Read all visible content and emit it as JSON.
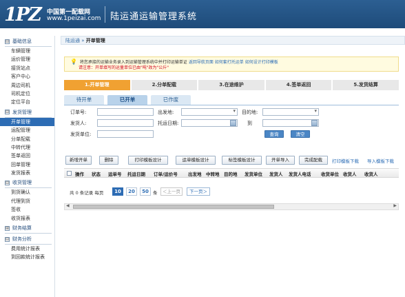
{
  "header": {
    "logo_mark": "1PZ",
    "logo_cn": "中国第一配载网",
    "logo_url": "www.1peizai.com",
    "app_title": "陆运通运输管理系统"
  },
  "sidebar": {
    "sections": [
      {
        "title": "基础信息",
        "toggle": "⊟",
        "items": [
          "车辆管理",
          "运价管理",
          "接货站点",
          "客户中心",
          "周边司机",
          "司机定位",
          "定位平台"
        ]
      },
      {
        "title": "发货管理",
        "toggle": "⊟",
        "items": [
          "开单管理",
          "运配管理",
          "分单配载",
          "中转代理",
          "签单返回",
          "回单管理",
          "发货报表"
        ]
      },
      {
        "title": "收货管理",
        "toggle": "⊟",
        "items": [
          "到货确认",
          "代理到货",
          "签收",
          "收货报表"
        ]
      },
      {
        "title": "财务结算",
        "toggle": "⊞",
        "items": []
      },
      {
        "title": "财务分析",
        "toggle": "⊟",
        "items": [
          "费用统计报表",
          "到回款统计报表"
        ]
      }
    ],
    "active_item": "开单管理"
  },
  "breadcrumb": {
    "parent": "陆运通",
    "sep": "»",
    "current": "开单管理"
  },
  "notice": {
    "text": "将您承接的运输业务录入到运输管理系统中并打印运输单证",
    "links": [
      "返回导航页面",
      "如何套打托运单",
      "如何设计打印模板"
    ],
    "warning": "请注意：开单填写的运量单位已由\"吨\"改为\"公斤\""
  },
  "steps": [
    "1.开单管理",
    "2.分单配载",
    "3.在途维护",
    "4.签单返回",
    "5.发货结算"
  ],
  "active_step": 0,
  "tabs": [
    "待开单",
    "已开单",
    "已作废"
  ],
  "active_tab": 1,
  "form": {
    "order_no_label": "订单号:",
    "origin_label": "出发地:",
    "dest_label": "目的地:",
    "sender_label": "发货人:",
    "ship_date_label": "托运日期:",
    "to_label": "到",
    "sender_unit_label": "发货单位:",
    "query_button": "查询",
    "clear_button": "清空"
  },
  "toolbar": {
    "buttons": [
      "新增开单",
      "删除",
      "打印模板设计",
      "运单模板设计",
      "标签模板设计",
      "开单导入",
      "完成配载"
    ],
    "links": [
      "打印模板下载",
      "导入模板下载"
    ]
  },
  "grid": {
    "columns": [
      "操作",
      "状态",
      "运单号",
      "托运日期",
      "订单/运价号",
      "出发地",
      "中转地",
      "目的地",
      "发货单位",
      "发货人",
      "发货人电话",
      "收货单位",
      "收货人",
      "收货人"
    ]
  },
  "pager": {
    "summary": "共 0 条记录 每页",
    "sizes": [
      "10",
      "20",
      "50"
    ],
    "active_size": "10",
    "unit": "条",
    "prev": "＜上一页",
    "next": "下一页＞"
  },
  "colors": {
    "header_blue": "#1e4b7a",
    "active_blue": "#2d6cb4",
    "step_orange": "#f0a132",
    "link_blue": "#2c6db5"
  }
}
